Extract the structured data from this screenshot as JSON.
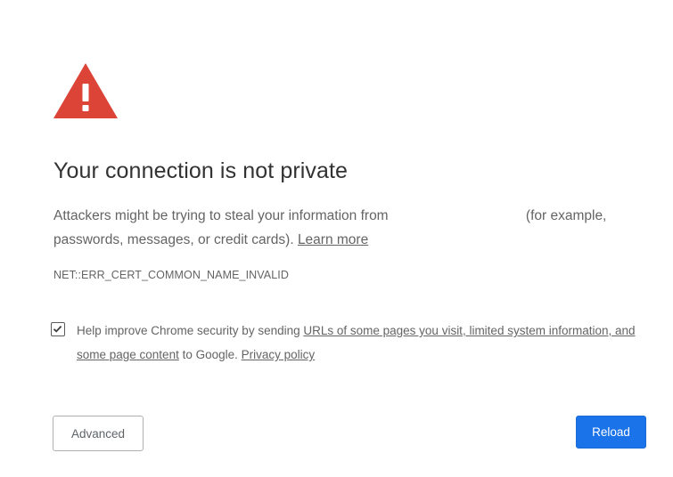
{
  "interstitial": {
    "heading": "Your connection is not private",
    "explanation_before": "Attackers might be trying to steal your information from",
    "explanation_after": " (for example, passwords, messages, or credit cards). ",
    "learn_more_link": "Learn more",
    "error_code": "NET::ERR_CERT_COMMON_NAME_INVALID",
    "icon": "red-warning-triangle-icon",
    "accent_color": "#db4437"
  },
  "optin": {
    "checked": true,
    "text_before": "Help improve Chrome security by sending ",
    "data_link": "URLs of some pages you visit, limited system information, and some page content",
    "text_middle": " to Google. ",
    "privacy_link": "Privacy policy"
  },
  "buttons": {
    "advanced_label": "Advanced",
    "reload_label": "Reload",
    "primary_color": "#1a73e8"
  }
}
